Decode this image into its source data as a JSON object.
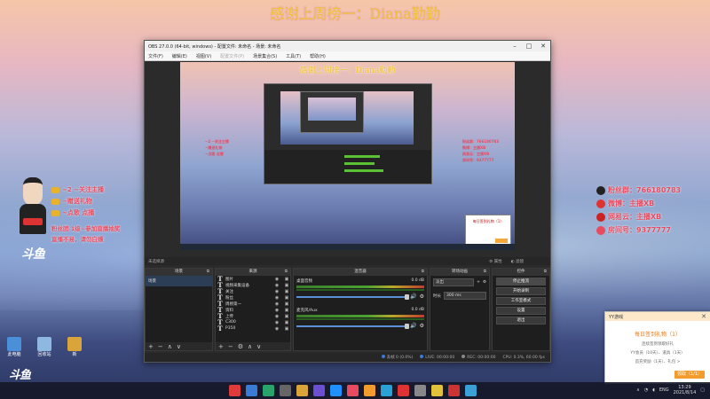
{
  "banner": {
    "text": "感谢上周榜一：Diana勤勤"
  },
  "overlay_left": {
    "items": [
      {
        "label": "~2 ~关注主播"
      },
      {
        "label": "~赠送礼物"
      },
      {
        "label": "~点歌 点播"
      }
    ],
    "notes": [
      "粉丝团 1级~参加直播抽奖",
      "直播不易，请勿白嫖"
    ],
    "logo": "斗鱼"
  },
  "overlay_right": {
    "items": [
      {
        "label": "粉丝群：766180783"
      },
      {
        "label": "微博：主播XB"
      },
      {
        "label": "网易云：主播XB"
      },
      {
        "label": "房间号：9377777"
      }
    ]
  },
  "desktop_icons": [
    {
      "label": "此电脑",
      "color": "#4a90d9"
    },
    {
      "label": "回收站",
      "color": "#8fb8e0"
    },
    {
      "label": "新",
      "color": "#d9a43a"
    }
  ],
  "obs": {
    "title": "OBS 27.0.0 (64-bit, windows) - 配置文件: 未命名 - 场景: 未命名",
    "menu": [
      "文件(F)",
      "编辑(E)",
      "视图(V)",
      "配置文件(P)",
      "场景集合(S)",
      "工具(T)",
      "帮助(H)"
    ],
    "preview_banner": "感谢上周榜一：Diana勤勤",
    "scene_toolbar_label": "未选择源",
    "scene_toolbar_props": "⚙ 属性",
    "scene_toolbar_filters": "◐ 滤镜",
    "panels": {
      "scenes": {
        "title": "场景",
        "items": [
          "场景"
        ]
      },
      "sources": {
        "title": "来源",
        "items": [
          {
            "name": "图片",
            "icon": "T"
          },
          {
            "name": "视频采集设备",
            "icon": "T"
          },
          {
            "name": "关注",
            "icon": "T"
          },
          {
            "name": "粉丝",
            "icon": "T"
          },
          {
            "name": "周榜第一",
            "icon": "T"
          },
          {
            "name": "资料",
            "icon": "T"
          },
          {
            "name": "上传",
            "icon": "T"
          },
          {
            "name": "C300",
            "icon": "T"
          },
          {
            "name": "P350",
            "icon": "T"
          }
        ]
      },
      "mixer": {
        "title": "混音器",
        "channels": [
          {
            "name": "桌面音频",
            "db": "0.0 dB"
          },
          {
            "name": "麦克风/Aux",
            "db": "0.0 dB"
          }
        ]
      },
      "transitions": {
        "title": "转场动画",
        "type": "淡出",
        "duration_label": "时长",
        "duration": "300 ms"
      },
      "controls": {
        "title": "控件",
        "buttons": [
          "停止推流",
          "开始录制",
          "工作室模式",
          "设置",
          "退出"
        ]
      }
    },
    "status": {
      "dropped": "丢帧 0 (0.0%)",
      "live": "LIVE: 00:00:00",
      "rec": "REC: 00:00:00",
      "cpu": "CPU: 0.3%, 60.00 fps"
    }
  },
  "popup": {
    "header": "YY游戏",
    "title": "每日签到礼物（1）",
    "lines": [
      "连续签到领取好礼",
      "YY会员（10天）、道具（1天）",
      "首充奖励（1天）、礼包 >"
    ],
    "button": "领取（1/1）"
  },
  "taskbar": {
    "tray": {
      "lang": "ENG",
      "time": "13:29",
      "date": "2021/8/14"
    },
    "icon_colors": [
      "#e03b3b",
      "#3a7bd5",
      "#27a36b",
      "#666",
      "#d9a43a",
      "#6b4fd0",
      "#1e90ff",
      "#e84a5f",
      "#f39c2d",
      "#2aa1d5",
      "#d33",
      "#888",
      "#e0c23b",
      "#c33",
      "#3aa0d5"
    ]
  }
}
